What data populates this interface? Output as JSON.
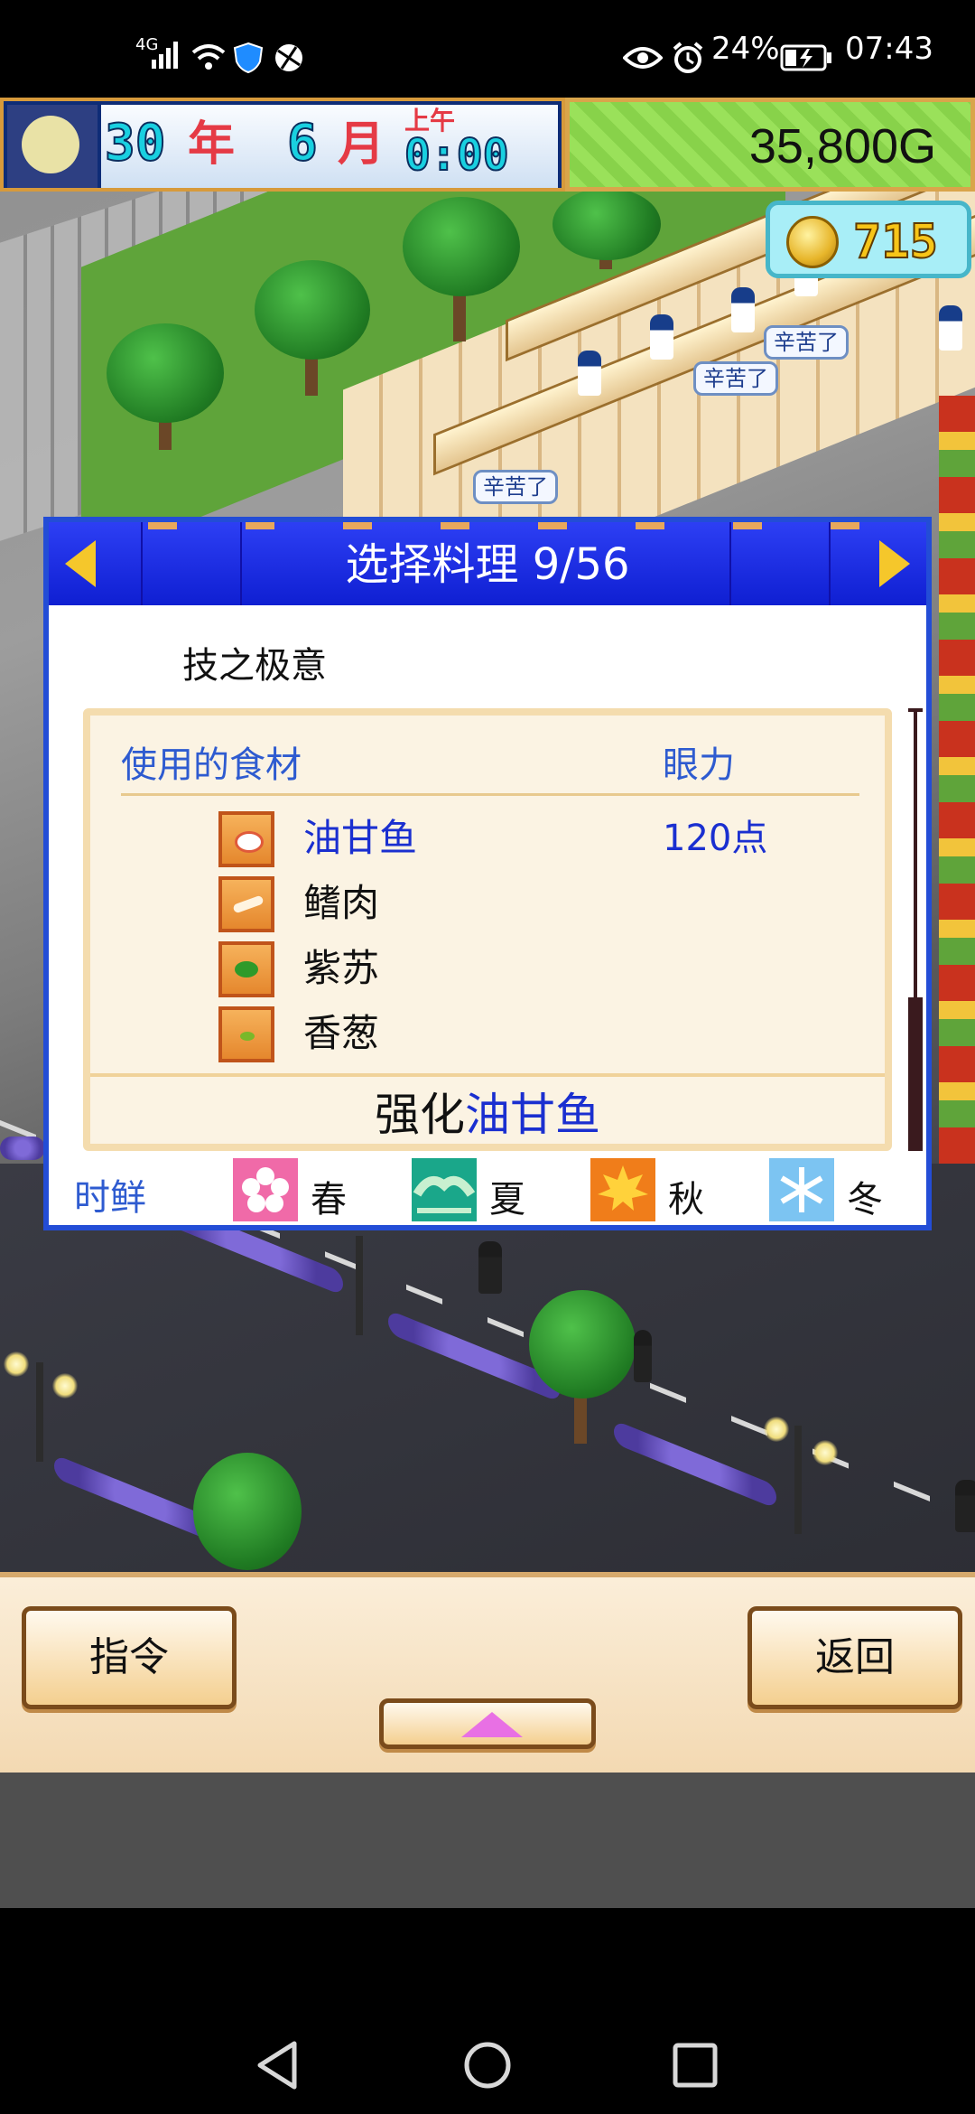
{
  "status_bar": {
    "network": "4G",
    "battery": "24%",
    "time": "07:43"
  },
  "hud": {
    "year_value": "30",
    "year_unit": "年",
    "month_value": "6",
    "month_unit": "月",
    "time_period": "上午",
    "clock": "0:00",
    "money": "35,800G",
    "coins": "715"
  },
  "scene": {
    "bubbles": [
      "辛苦了",
      "辛苦了",
      "辛苦了"
    ]
  },
  "dialog": {
    "title": "选择料理 9/56",
    "dish_name": "技之极意",
    "ingredients_header": "使用的食材",
    "stat_header": "眼力",
    "ingredients": [
      {
        "name": "油甘鱼",
        "value": "120点",
        "icon": "fish-icon",
        "highlight": true
      },
      {
        "name": "鳍肉",
        "value": "",
        "icon": "fin-meat-icon",
        "highlight": false
      },
      {
        "name": "紫苏",
        "value": "",
        "icon": "shiso-icon",
        "highlight": false
      },
      {
        "name": "香葱",
        "value": "",
        "icon": "scallion-icon",
        "highlight": false
      }
    ],
    "effect_prefix": "强化",
    "effect_target": "油甘鱼",
    "season_label": "时鲜",
    "seasons": [
      {
        "name": "春",
        "icon": "cherry-blossom-icon",
        "color": "#f06aa8"
      },
      {
        "name": "夏",
        "icon": "wave-icon",
        "color": "#1aa78a"
      },
      {
        "name": "秋",
        "icon": "maple-leaf-icon",
        "color": "#f07d1a"
      },
      {
        "name": "冬",
        "icon": "snowflake-icon",
        "color": "#7cc4f2"
      }
    ]
  },
  "buttons": {
    "command": "指令",
    "back": "返回"
  },
  "colors": {
    "dialog_header": "#1f2fe6",
    "highlight_text": "#1a2fd0",
    "label_text": "#2e5bd0",
    "money_bg": "#9ae15a"
  }
}
